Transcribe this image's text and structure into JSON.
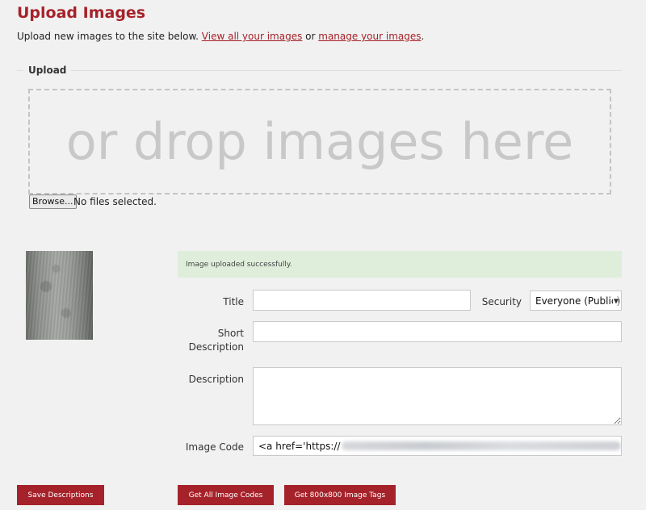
{
  "header": {
    "title": "Upload Images",
    "intro_before": "Upload new images to the site below. ",
    "link_view_all": "View all your images",
    "intro_middle": " or ",
    "link_manage": "manage your images",
    "intro_end": "."
  },
  "upload": {
    "legend": "Upload",
    "dropzone_text": "or drop images here",
    "browse_label": "Browse...",
    "file_status": "No files selected."
  },
  "image_form": {
    "success_message": "Image uploaded successfully.",
    "title_label": "Title",
    "title_value": "",
    "security_label": "Security",
    "security_selected": "Everyone (Public)",
    "short_description_label": "Short Description",
    "short_description_value": "",
    "description_label": "Description",
    "description_value": "",
    "image_code_label": "Image Code",
    "image_code_prefix": "<a href='https://"
  },
  "actions": {
    "save_descriptions": "Save Descriptions",
    "get_all_codes": "Get All Image Codes",
    "get_800_tags": "Get 800x800 Image Tags"
  },
  "colors": {
    "accent": "#a6222a",
    "success_bg": "#dfeedb",
    "page_bg": "#f1f1f1"
  }
}
